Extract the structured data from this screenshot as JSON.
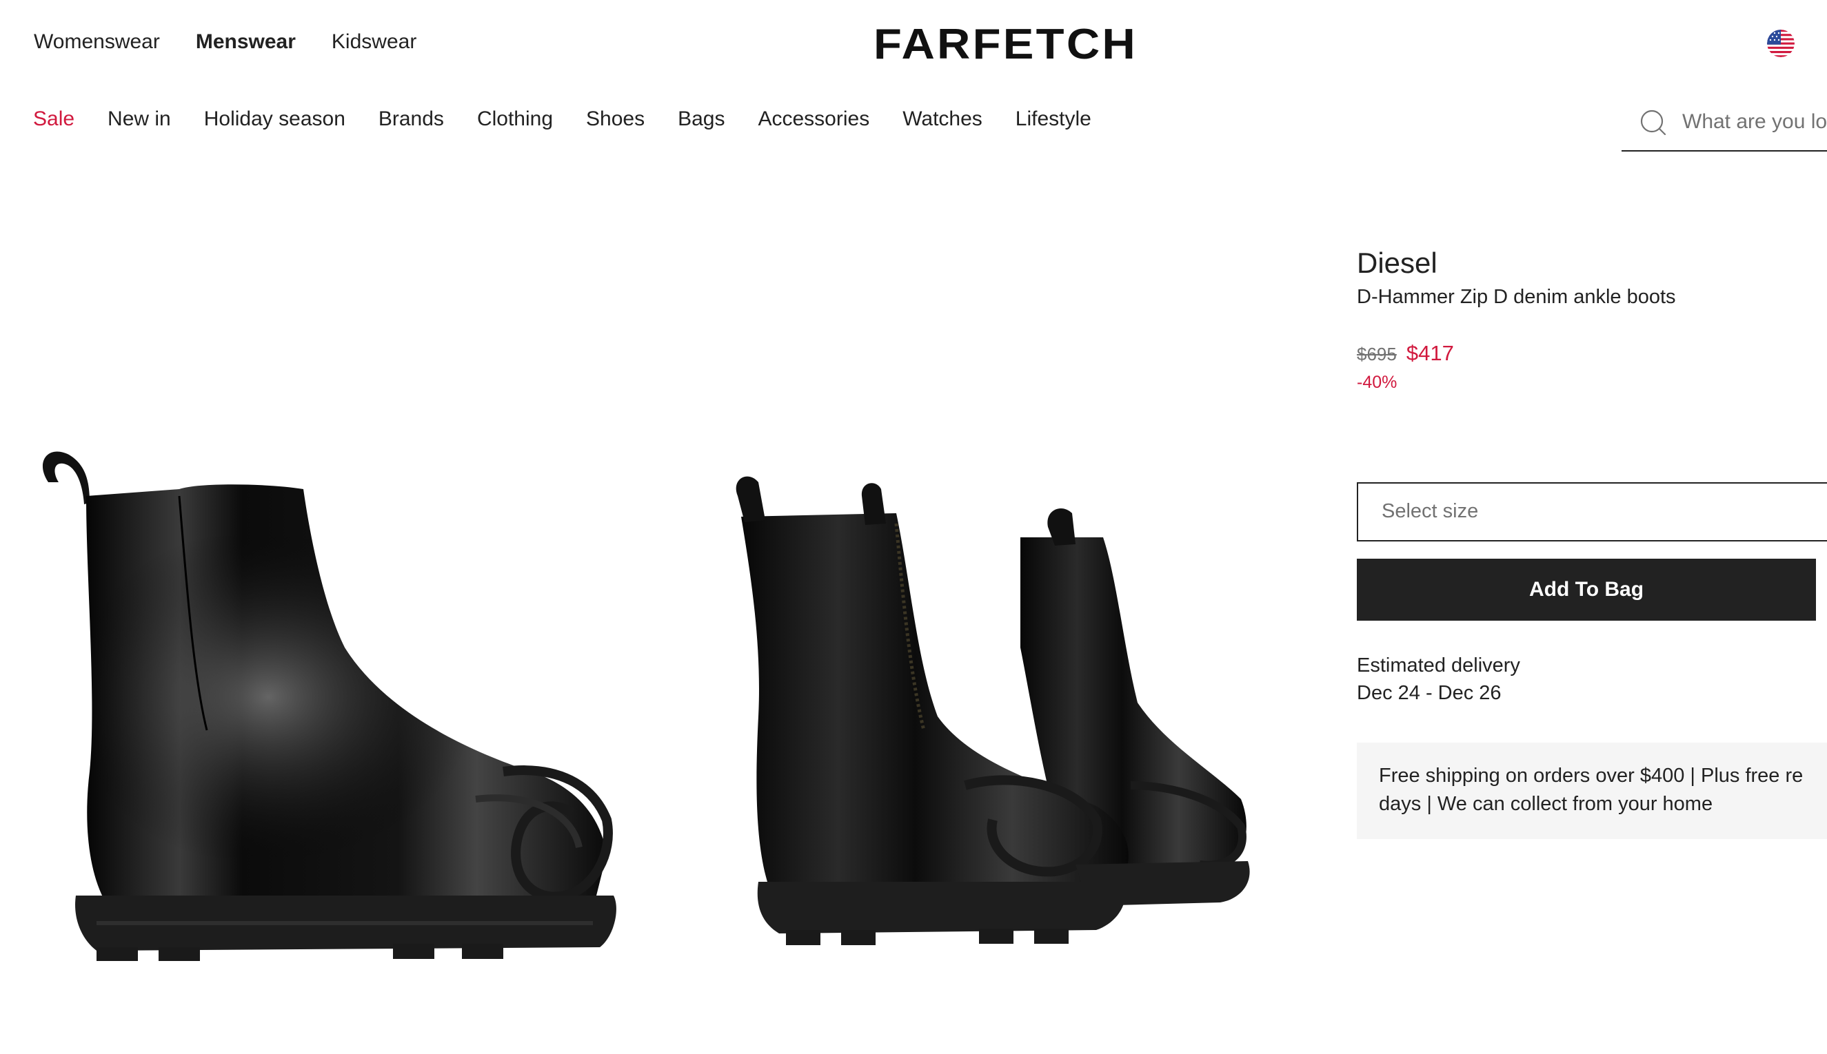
{
  "header": {
    "logo": "FARFETCH",
    "gender_nav": [
      "Womenswear",
      "Menswear",
      "Kidswear"
    ],
    "active_gender": "Menswear",
    "region_flag": "us-flag-icon"
  },
  "category_nav": {
    "items": [
      "Sale",
      "New in",
      "Holiday season",
      "Brands",
      "Clothing",
      "Shoes",
      "Bags",
      "Accessories",
      "Watches",
      "Lifestyle"
    ]
  },
  "search": {
    "placeholder": "What are you lo",
    "icon": "search-icon"
  },
  "product": {
    "brand": "Diesel",
    "name": "D-Hammer Zip D denim ankle boots",
    "original_price": "$695",
    "sale_price": "$417",
    "discount": "-40%",
    "size_placeholder": "Select size",
    "add_to_bag_label": "Add To Bag",
    "delivery_label": "Estimated delivery",
    "delivery_dates": "Dec 24 - Dec 26",
    "shipping_info": "Free shipping on orders over $400 | Plus free re days | We can collect from your home"
  },
  "shipping_lines": [
    "Free shipping on orders over $400 | Plus free re",
    "days | We can collect from your home"
  ],
  "colors": {
    "sale_red": "#d1193e",
    "text": "#222222",
    "muted": "#727272",
    "banner_bg": "#f5f5f5",
    "button_bg": "#222222"
  }
}
